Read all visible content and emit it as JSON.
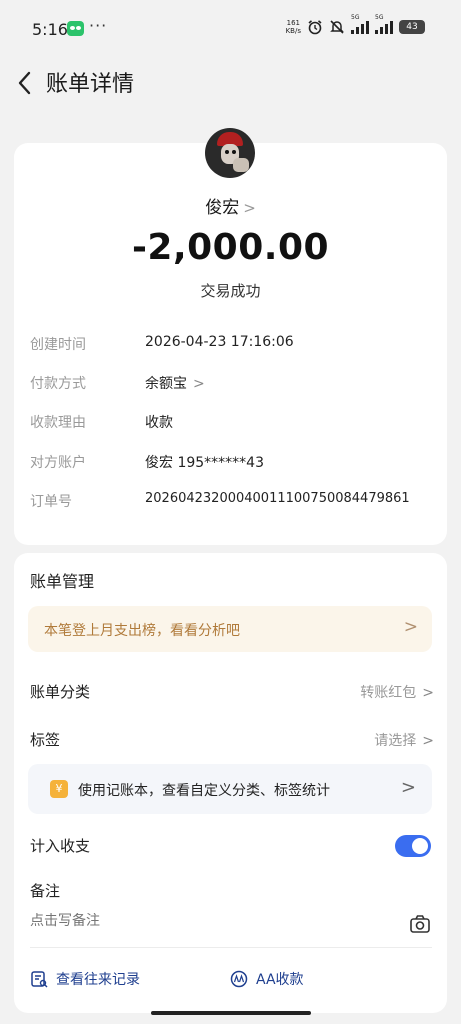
{
  "status_bar": {
    "time": "5:16",
    "more": "···",
    "net_speed": "161",
    "net_unit": "KB/s",
    "signal1_tag": "5G",
    "signal2_tag": "5G",
    "battery": "43"
  },
  "nav": {
    "title": "账单详情"
  },
  "transaction": {
    "payee": "俊宏",
    "amount": "-2,000.00",
    "status": "交易成功",
    "details": [
      {
        "label": "创建时间",
        "value": "2026-04-23 17:16:06"
      },
      {
        "label": "付款方式",
        "value": "余额宝"
      },
      {
        "label": "收款理由",
        "value": "收款"
      },
      {
        "label": "对方账户",
        "value": "俊宏 195******43"
      },
      {
        "label": "订单号",
        "value": "20260423200040011100750084479861"
      }
    ]
  },
  "management": {
    "title": "账单管理",
    "promo": "本笔登上月支出榜，看看分析吧",
    "category_label": "账单分类",
    "category_value": "转账红包",
    "tag_label": "标签",
    "tag_value": "请选择",
    "ledger_icon": "¥",
    "ledger_tip": "使用记账本，查看自定义分类、标签统计",
    "include_label": "计入收支",
    "include_on": true,
    "note_label": "备注",
    "note_placeholder": "点击写备注",
    "history_link": "查看往来记录",
    "aa_link": "AA收款"
  },
  "colors": {
    "accent": "#3a6df0",
    "link": "#1f3f8f",
    "promo_text": "#b07a3a",
    "promo_bg": "#fbf5ea"
  }
}
